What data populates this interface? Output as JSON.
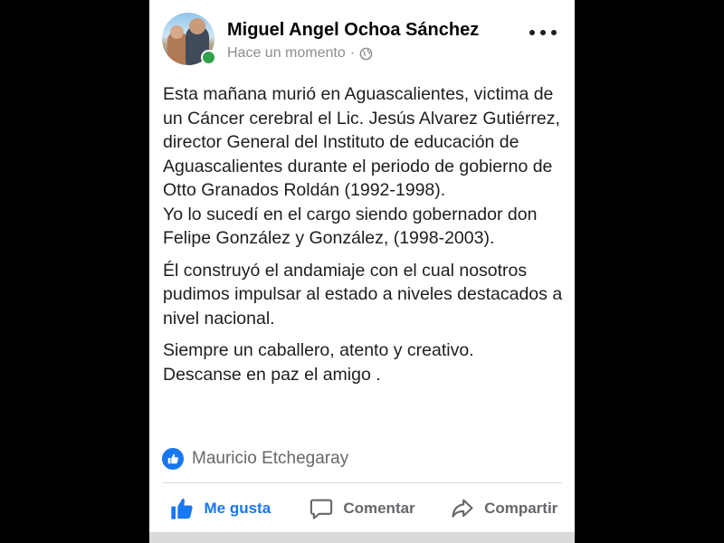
{
  "post": {
    "author": "Miguel Angel Ochoa Sánchez",
    "timestamp": "Hace un momento",
    "separator": "·",
    "privacy_icon": "globe-icon",
    "paragraphs": [
      [
        "Esta mañana murió en Aguascalientes, victima de un Cáncer cerebral el Lic. Jesús Alvarez Gutiérrez, director General del Instituto de educación de Aguascalientes durante el periodo de gobierno de Otto Granados Roldán (1992-1998).",
        "Yo lo sucedí en el cargo siendo gobernador don Felipe González y González, (1998-2003)."
      ],
      [
        "Él construyó el andamiaje con el cual nosotros pudimos impulsar al estado a niveles destacados a nivel nacional."
      ],
      [
        "Siempre un caballero, atento y creativo.",
        "Descanse en paz el amigo ."
      ]
    ]
  },
  "reactions": {
    "icon": "like-icon",
    "names": "Mauricio Etchegaray"
  },
  "actions": {
    "like_label": "Me gusta",
    "comment_label": "Comentar",
    "share_label": "Compartir"
  },
  "colors": {
    "accent": "#1877f2",
    "text": "#1c1e21",
    "muted": "#65676b",
    "online": "#31a24c"
  }
}
